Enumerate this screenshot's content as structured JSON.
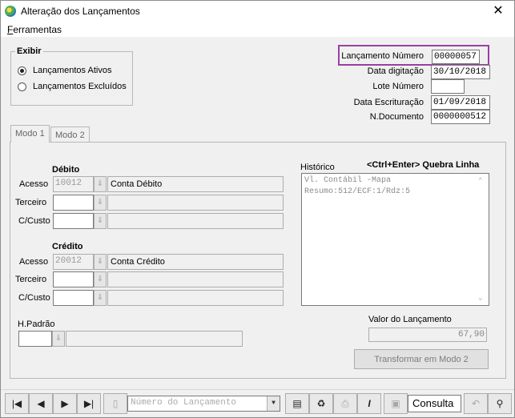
{
  "window": {
    "title": "Alteração dos Lançamentos",
    "close_symbol": "✕"
  },
  "menu": {
    "ferramentas": "Ferramentas"
  },
  "exibir": {
    "legend": "Exibir",
    "options": [
      {
        "label": "Lançamentos Ativos",
        "checked": true
      },
      {
        "label": "Lançamentos Excluídos",
        "checked": false
      }
    ]
  },
  "header": {
    "lancamento_numero_label": "Lançamento Número",
    "lancamento_numero_value": "00000057",
    "data_digitacao_label": "Data digitação",
    "data_digitacao_value": "30/10/2018",
    "lote_numero_label": "Lote Número",
    "lote_numero_value": "",
    "data_escrituracao_label": "Data Escrituração",
    "data_escrituracao_value": "01/09/2018",
    "n_documento_label": "N.Documento",
    "n_documento_value": "0000000512"
  },
  "tabs": [
    {
      "label": "Modo 1"
    },
    {
      "label": "Modo 2"
    }
  ],
  "debito": {
    "title": "Débito",
    "acesso_label": "Acesso",
    "acesso_value": "10012",
    "acesso_desc": "Conta Débito",
    "terceiro_label": "Terceiro",
    "ccusto_label": "C/Custo"
  },
  "credito": {
    "title": "Crédito",
    "acesso_label": "Acesso",
    "acesso_value": "20012",
    "acesso_desc": "Conta Crédito",
    "terceiro_label": "Terceiro",
    "ccusto_label": "C/Custo"
  },
  "historico": {
    "label": "Histórico",
    "hint": "<Ctrl+Enter> Quebra Linha",
    "line1": "Vl. Contábil -Mapa",
    "line2": "Resumo:512/ECF:1/Rdz:5"
  },
  "hpadrao_label": "H.Padrão",
  "valor": {
    "label": "Valor do Lançamento",
    "value": "67,90"
  },
  "transformar_button": "Transformar em Modo 2",
  "toolbar": {
    "search_placeholder": "Número do Lançamento",
    "mode": "Consulta"
  },
  "colors": {
    "highlight": "#9b3ea2"
  }
}
